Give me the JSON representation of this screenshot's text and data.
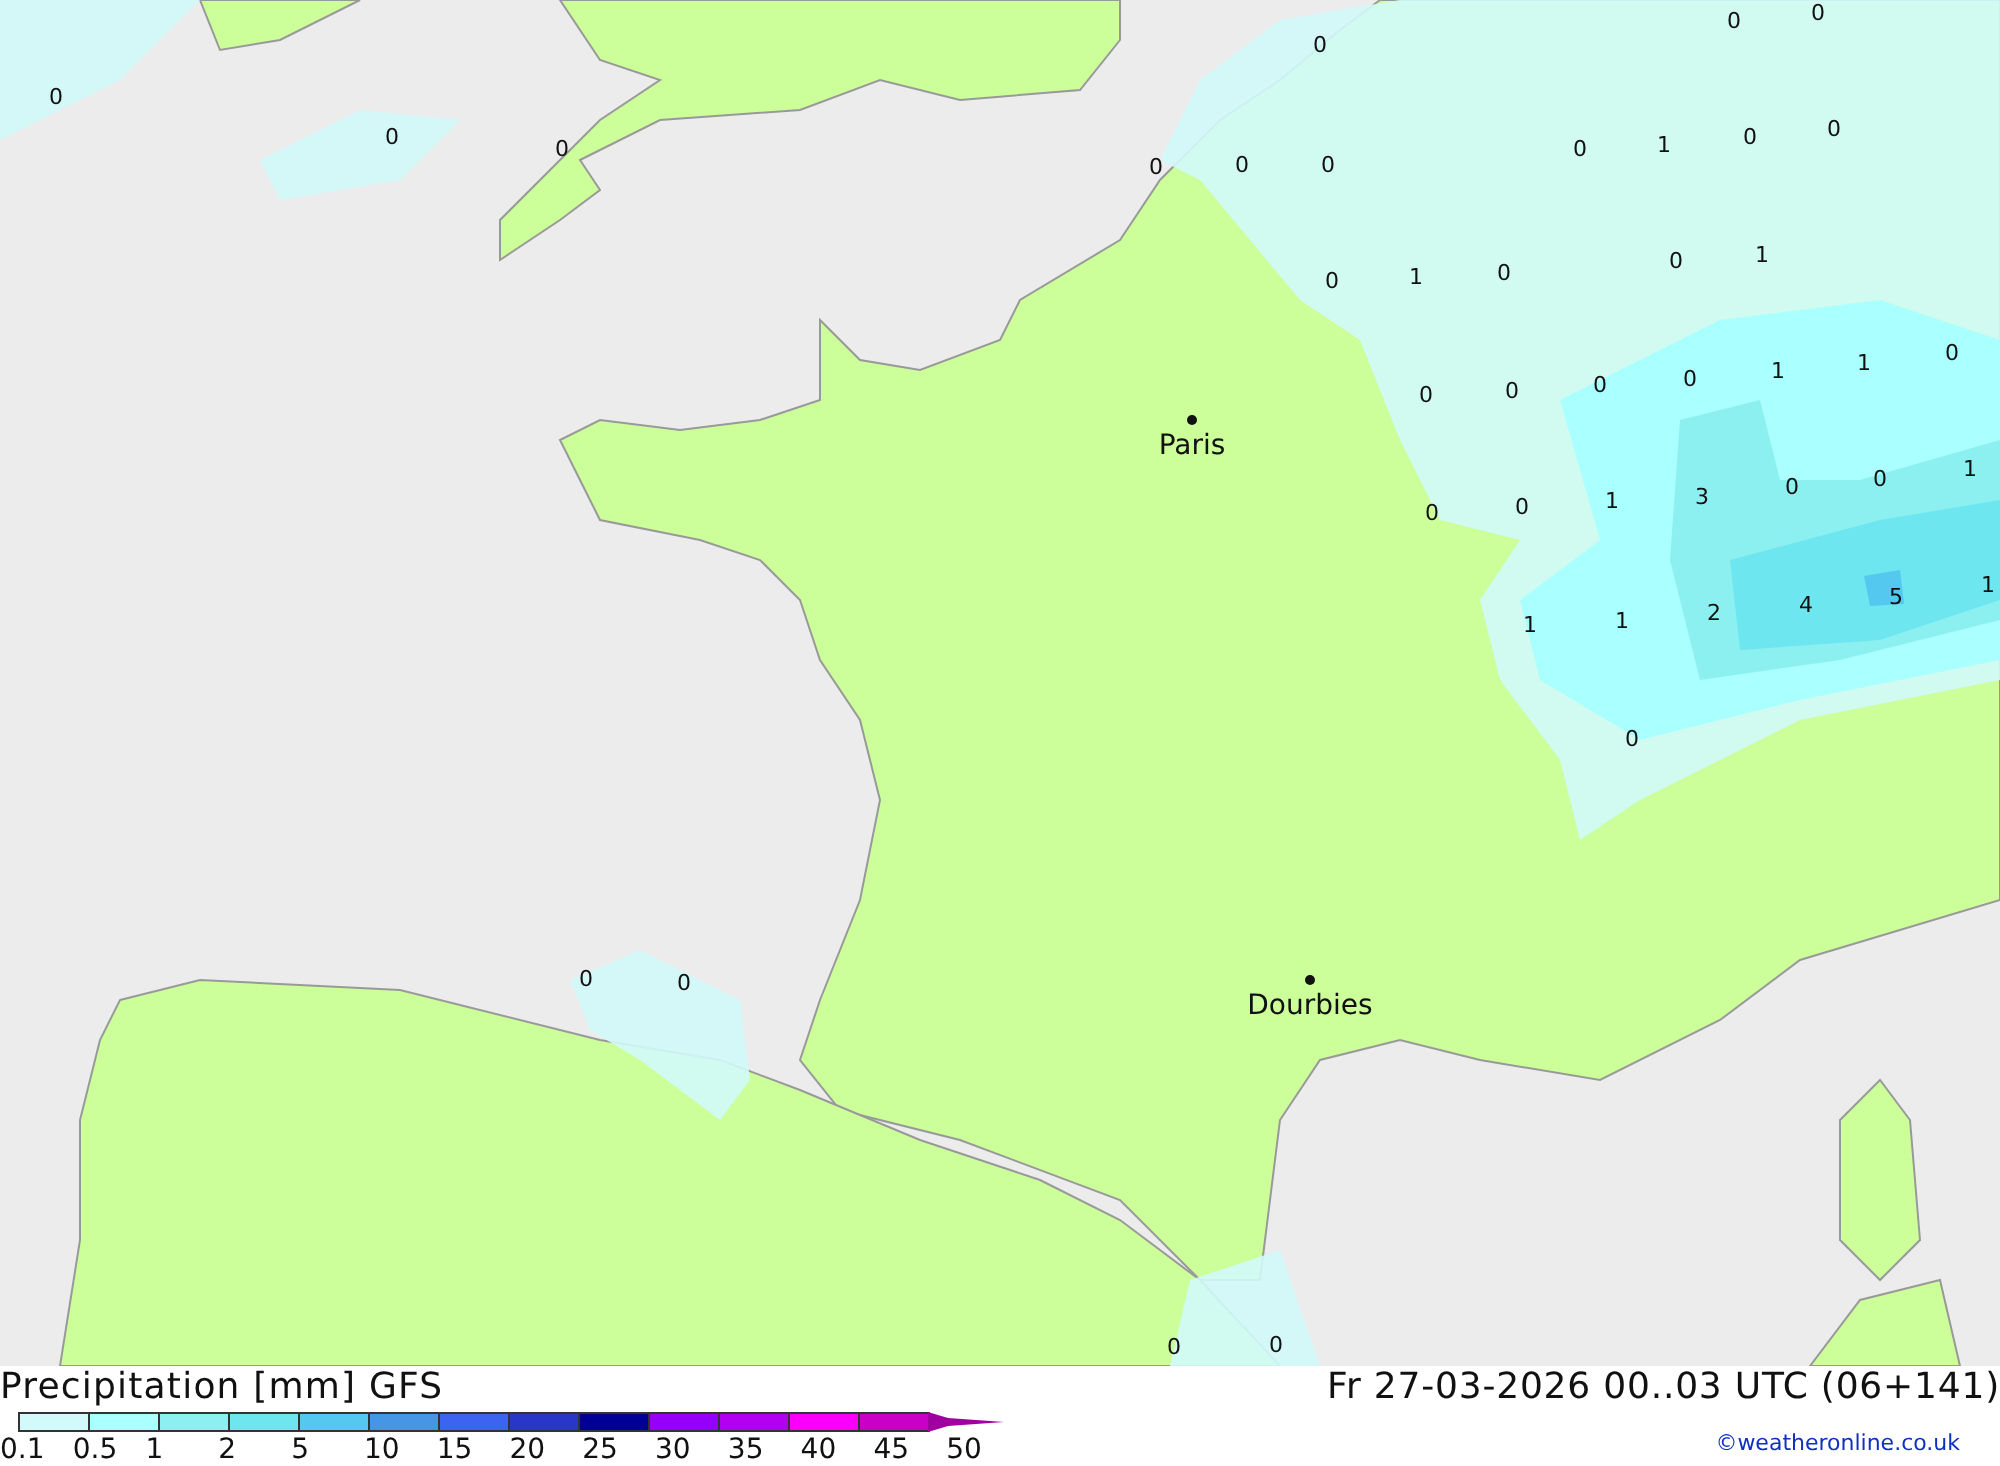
{
  "map": {
    "cities": [
      {
        "name": "Paris"
      },
      {
        "name": "Dourbies"
      }
    ],
    "values": [
      "0",
      "0",
      "0",
      "0",
      "0",
      "0",
      "0",
      "0",
      "1",
      "0",
      "0",
      "0",
      "0",
      "0",
      "1",
      "0",
      "0",
      "1",
      "0",
      "1",
      "1",
      "0",
      "0",
      "0",
      "0",
      "0",
      "0",
      "1",
      "3",
      "0",
      "0",
      "1",
      "1",
      "1",
      "2",
      "4",
      "5",
      "1",
      "0",
      "0",
      "0",
      "0",
      "0"
    ]
  },
  "footer": {
    "title": "Precipitation [mm] GFS",
    "valid_time": "Fr 27-03-2026 00..03 UTC (06+141)",
    "credit": "©weatheronline.co.uk"
  },
  "legend": {
    "steps": [
      {
        "color": "#d2fafa"
      },
      {
        "color": "#aaffff"
      },
      {
        "color": "#8cf0f0"
      },
      {
        "color": "#6ee6f0"
      },
      {
        "color": "#55c8f0"
      },
      {
        "color": "#4696e6"
      },
      {
        "color": "#3c64f0"
      },
      {
        "color": "#2837c8"
      },
      {
        "color": "#000096"
      },
      {
        "color": "#9600fa"
      },
      {
        "color": "#b400f0"
      },
      {
        "color": "#fa00fa"
      },
      {
        "color": "#c800c8"
      },
      {
        "color": "#a000a0"
      }
    ],
    "ticks": [
      "0.1",
      "0.5",
      "1",
      "2",
      "5",
      "10",
      "15",
      "20",
      "25",
      "30",
      "35",
      "40",
      "45",
      "50"
    ]
  }
}
